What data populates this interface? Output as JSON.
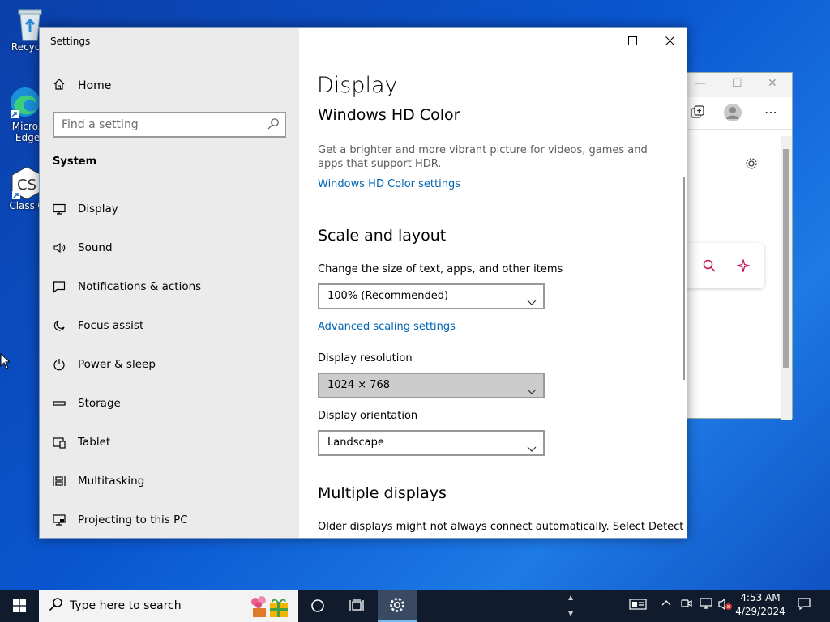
{
  "desktop": {
    "icons": [
      {
        "label": "Recycle"
      },
      {
        "label": "Micros Edge"
      },
      {
        "label": "ClassiC"
      }
    ]
  },
  "settings_window": {
    "app_title": "Settings",
    "nav": {
      "home_label": "Home",
      "search_placeholder": "Find a setting",
      "section_header": "System",
      "items": [
        {
          "label": "Display",
          "icon": "monitor-icon"
        },
        {
          "label": "Sound",
          "icon": "speaker-icon"
        },
        {
          "label": "Notifications & actions",
          "icon": "notification-icon"
        },
        {
          "label": "Focus assist",
          "icon": "moon-icon"
        },
        {
          "label": "Power & sleep",
          "icon": "power-icon"
        },
        {
          "label": "Storage",
          "icon": "storage-icon"
        },
        {
          "label": "Tablet",
          "icon": "tablet-icon"
        },
        {
          "label": "Multitasking",
          "icon": "multitasking-icon"
        },
        {
          "label": "Projecting to this PC",
          "icon": "projecting-icon"
        }
      ]
    },
    "content": {
      "page_title": "Display",
      "hdr": {
        "heading": "Windows HD Color",
        "description": "Get a brighter and more vibrant picture for videos, games and apps that support HDR.",
        "link": "Windows HD Color settings"
      },
      "scale": {
        "heading": "Scale and layout",
        "size_label": "Change the size of text, apps, and other items",
        "size_value": "100% (Recommended)",
        "advanced_link": "Advanced scaling settings",
        "resolution_label": "Display resolution",
        "resolution_value": "1024 × 768",
        "orientation_label": "Display orientation",
        "orientation_value": "Landscape"
      },
      "multiple": {
        "heading": "Multiple displays",
        "description": "Older displays might not always connect automatically. Select Detect"
      }
    }
  },
  "taskbar": {
    "search_placeholder": "Type here to search",
    "clock_time": "4:53 AM",
    "clock_date": "4/29/2024",
    "accent_color": "#76b9ed"
  }
}
